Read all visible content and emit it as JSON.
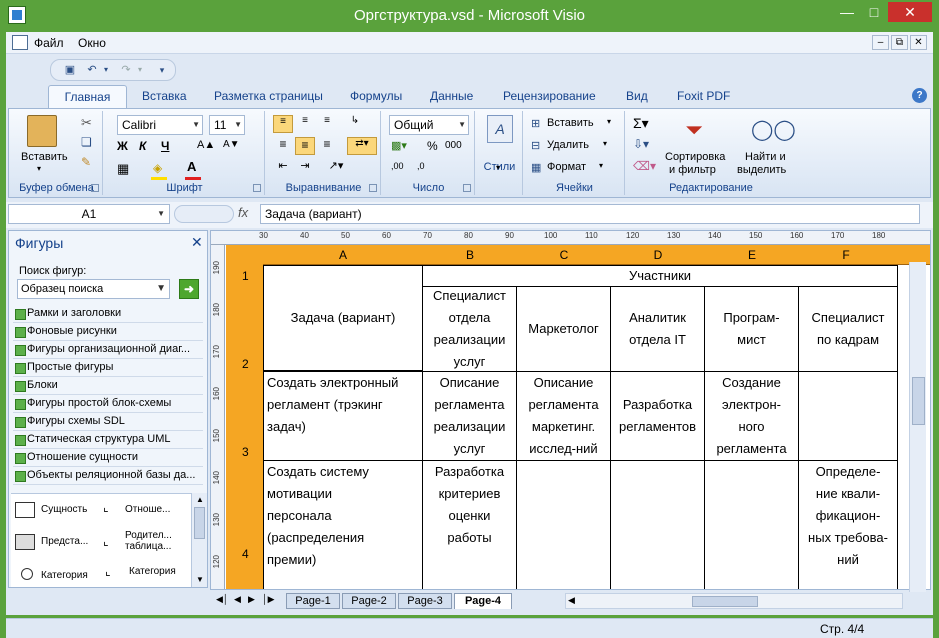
{
  "window": {
    "title": "Оргструктура.vsd - Microsoft Visio"
  },
  "menu": {
    "file": "Файл",
    "window": "Окно"
  },
  "tabs": [
    "Главная",
    "Вставка",
    "Разметка страницы",
    "Формулы",
    "Данные",
    "Рецензирование",
    "Вид",
    "Foxit PDF"
  ],
  "ribbon": {
    "clipboard": {
      "paste": "Вставить",
      "label": "Буфер обмена"
    },
    "font": {
      "name": "Calibri",
      "size": "11",
      "label": "Шрифт"
    },
    "alignment": {
      "label": "Выравнивание"
    },
    "number": {
      "format": "Общий",
      "label": "Число",
      "percent": "%",
      "thousands": "000",
      "dec_inc": ",00",
      "dec_dec": ",0"
    },
    "styles": {
      "label": "Стили"
    },
    "cells": {
      "insert": "Вставить",
      "delete": "Удалить",
      "format": "Формат",
      "label": "Ячейки"
    },
    "editing": {
      "sort": "Сортировка",
      "sort2": "и фильтр",
      "find": "Найти и",
      "find2": "выделить",
      "label": "Редактирование"
    }
  },
  "formula": {
    "namebox": "A1",
    "fx": "fx",
    "content": "Задача (вариант)"
  },
  "pane": {
    "title": "Фигуры",
    "search_label": "Поиск фигур:",
    "search_placeholder": "Образец поиска",
    "stencils": [
      "Рамки и заголовки",
      "Фоновые рисунки",
      "Фигуры организационной диаг...",
      "Простые фигуры",
      "Блоки",
      "Фигуры простой блок-схемы",
      "Фигуры схемы SDL",
      "Статическая структура UML",
      "Отношение сущности",
      "Объекты реляционной базы да..."
    ],
    "shapes": [
      "Сущность",
      "Отноше...",
      "Предста...",
      "Родител... таблица...",
      "Категория",
      "Категория"
    ]
  },
  "ruler": {
    "h": [
      "30",
      "40",
      "50",
      "60",
      "70",
      "80",
      "90",
      "100",
      "110",
      "120",
      "130",
      "140",
      "150",
      "160",
      "170",
      "180"
    ],
    "v": [
      "190",
      "180",
      "170",
      "160",
      "150",
      "140",
      "130",
      "120"
    ]
  },
  "sheet": {
    "columns": [
      "A",
      "B",
      "C",
      "D",
      "E",
      "F"
    ],
    "rows": [
      "1",
      "2",
      "3",
      "4"
    ],
    "header_merged": "Участники",
    "cells": {
      "a12": "Задача (вариант)",
      "b2": "Специалист\nотдела\nреализации\nуслуг",
      "c2": "Маркетолог",
      "d2": "Аналитик\nотдела IT",
      "e2": "Програм-\nмист",
      "f2": "Специалист\nпо кадрам",
      "a3": "Создать электронный\nрегламент (трэкинг\nзадач)",
      "b3": "Описание\nрегламента\nреализации\nуслуг",
      "c3": "Описание\nрегламента\nмаркетинг.\nисслед-ний",
      "d3": "Разработка\nрегламентов",
      "e3": "Создание\nэлектрон-\nного\nрегламента",
      "f3": "",
      "a4": "Создать систему\nмотивации\nперсонала\n(распределения\nпремии)",
      "b4": "Разработка\nкритериев\nоценки\nработы",
      "c4": "",
      "d4": "",
      "e4": "",
      "f4": "Определе-\nние квали-\nфикацион-\nных требова-\nний"
    }
  },
  "pages": [
    "Page-1",
    "Page-2",
    "Page-3",
    "Page-4"
  ],
  "active_page": "Page-4",
  "status": {
    "page": "Стр. 4/4"
  }
}
